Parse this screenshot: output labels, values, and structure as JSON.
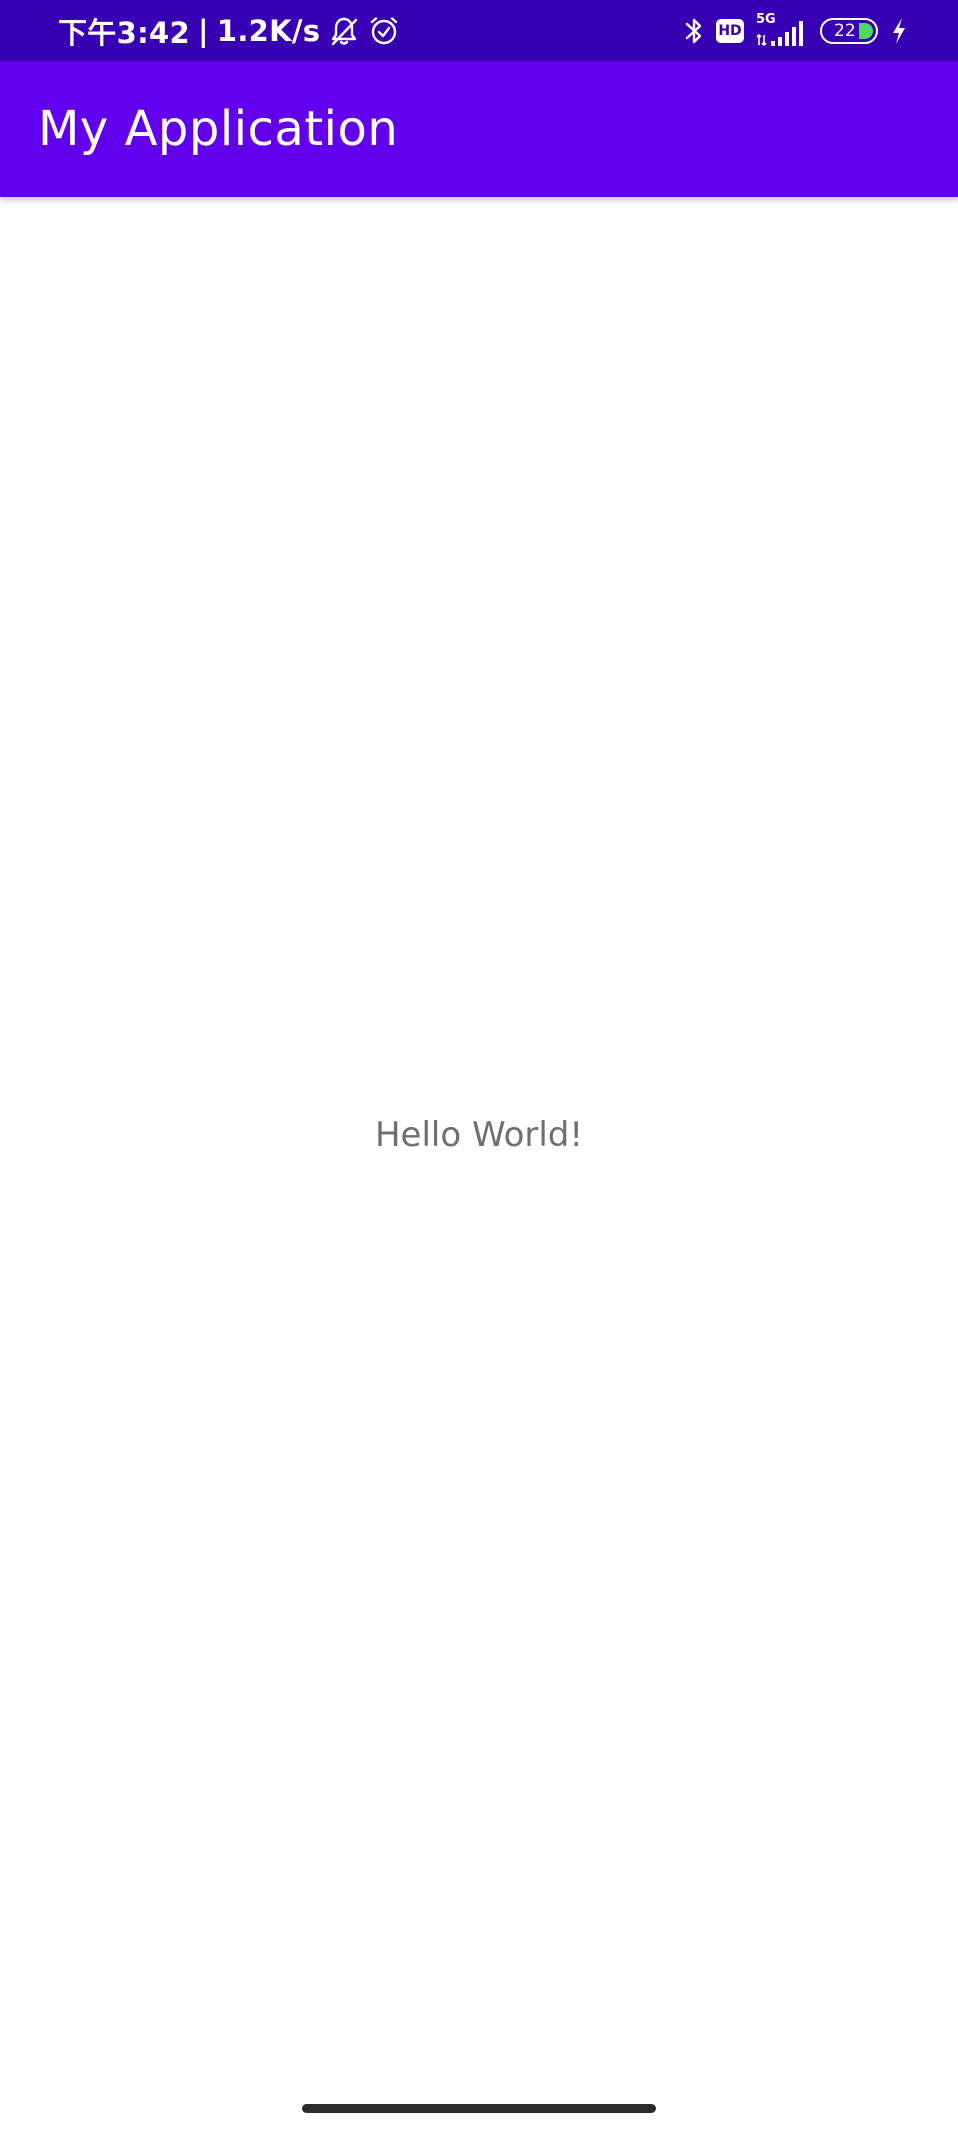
{
  "status_bar": {
    "time": "下午3:42",
    "separator": "|",
    "net_speed": "1.2K/s",
    "left_icons": [
      "bell-off-icon",
      "alarm-clock-icon"
    ],
    "right_icons": [
      "bluetooth-icon",
      "hd-badge",
      "signal-5g-icon",
      "battery-icon",
      "charging-bolt-icon"
    ],
    "hd_label": "HD",
    "network_label": "5G",
    "battery_level": "22",
    "battery_fill_color": "#4CD964",
    "background_color": "#3700B3"
  },
  "app_bar": {
    "title": "My Application",
    "background_color": "#6200EE"
  },
  "content": {
    "message": "Hello World!"
  }
}
